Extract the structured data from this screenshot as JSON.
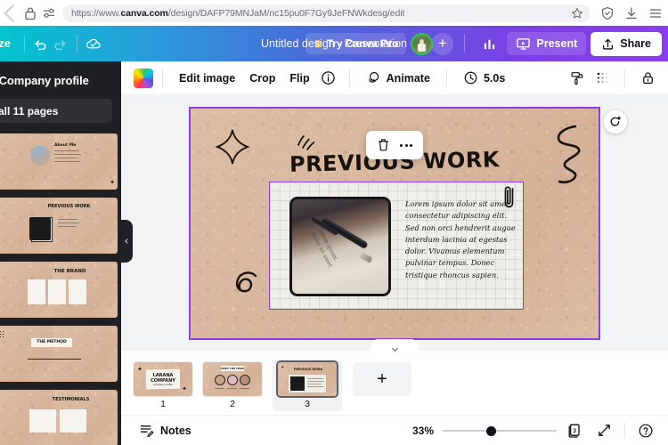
{
  "browser": {
    "url_prefix": "https://www.",
    "url_domain": "canva.com",
    "url_path": "/design/DAFP79MNJaM/nc15pu0F7Gy9JeFNWkdesg/edit",
    "back_icon": "back-chevron-icon",
    "lock_icon": "lock-icon",
    "tune_icon": "site-settings-icon",
    "star_icon": "bookmark-star-icon",
    "shield_icon": "shield-icon",
    "download_icon": "download-icon",
    "menu_icon": "hamburger-menu-icon"
  },
  "topbar": {
    "resize_label": "ize",
    "undo_icon": "undo-icon",
    "redo_icon": "redo-icon",
    "saved_icon": "cloud-saved-icon",
    "doc_title": "Untitled design - Presentation",
    "pro_label": "Try Canva Pro",
    "crown_icon": "crown-icon",
    "avatar_name": "user-avatar",
    "add_collaborator": "+",
    "insights_icon": "insights-chart-icon",
    "present_label": "Present",
    "present_icon": "present-screen-icon",
    "share_label": "Share",
    "share_icon": "share-upload-icon"
  },
  "sidepanel": {
    "title": "e Company profile",
    "all_pages_label": "all 11 pages",
    "thumbs": [
      {
        "name": "About me",
        "title": "About Me"
      },
      {
        "name": "Previous work",
        "title": "PREVIOUS WORK"
      },
      {
        "name": "The brand",
        "title": "THE BRAND"
      },
      {
        "name": "The method",
        "title": "THE METHOD"
      },
      {
        "name": "Testimonials",
        "title": "TESTIMONIALS"
      }
    ],
    "collapse_icon": "collapse-left-chevron-icon"
  },
  "toolbar": {
    "color_swatch": "rainbow-color-swatch",
    "edit_image": "Edit image",
    "crop": "Crop",
    "flip": "Flip",
    "info_icon": "info-circle-icon",
    "animate": "Animate",
    "animate_icon": "animate-icon",
    "timer_icon": "timer-clock-icon",
    "duration": "5.0s",
    "paint_icon": "paint-roller-icon",
    "transparency_icon": "transparency-grid-icon",
    "lock_icon": "lock-closed-icon"
  },
  "canvas": {
    "slide_title": "PREVIOUS WORK",
    "body_text": "Lorem ipsum dolor sit amet, consectetur adipiscing elit. Sed non orci hendrerit augue interdum lacinia at egestas dolor. Vivamus elementum pulvinar tempus. Donec tristique rhoncus sapien.",
    "photo_alt": "fountain pen on notepaper photo",
    "float_delete_icon": "trash-delete-icon",
    "float_more_icon": "more-options-icon",
    "add_page_icon": "duplicate-page-icon",
    "selection_color": "#8b3dee",
    "paper_color": "#d9b89f",
    "note_color": "#efeee9"
  },
  "tray": {
    "collapse_icon": "tray-collapse-chevron-icon",
    "pages": [
      {
        "num": "1",
        "title": "LARANA COMPANY",
        "subtitle": "Company profile"
      },
      {
        "num": "2",
        "title": "MEET THE TEAM"
      },
      {
        "num": "3",
        "title": "PREVIOUS WORK"
      }
    ],
    "add_page_label": "+"
  },
  "status": {
    "notes_label": "Notes",
    "notes_icon": "notes-icon",
    "zoom_value": "33%",
    "page_count": "3",
    "pagecount_icon": "page-count-icon",
    "fullscreen_icon": "expand-fullscreen-icon",
    "help_icon": "help-question-icon"
  }
}
